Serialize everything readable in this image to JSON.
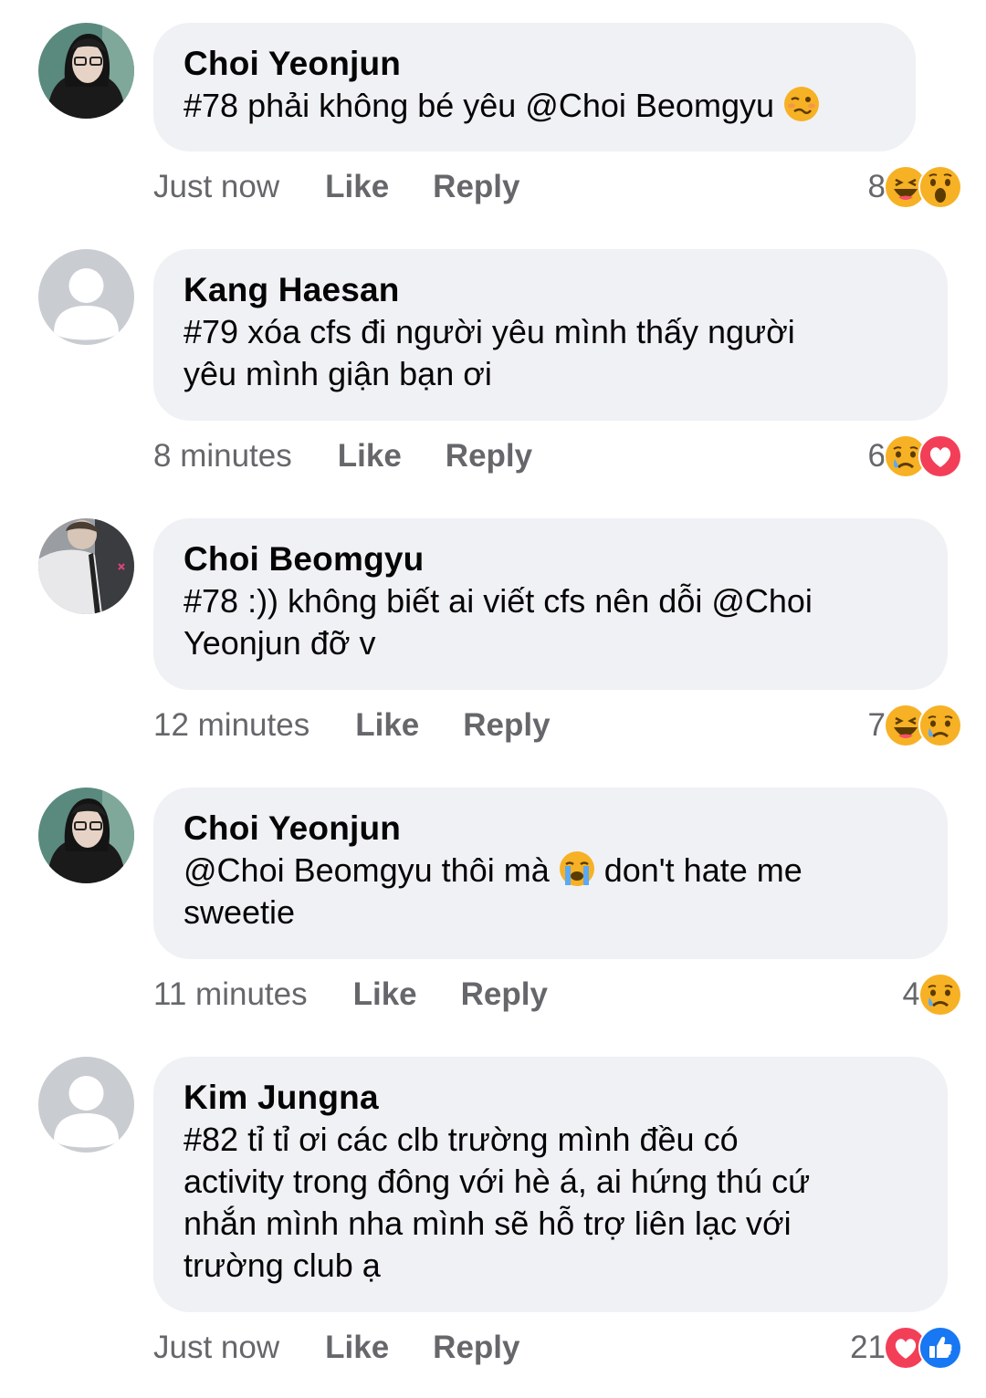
{
  "comments": [
    {
      "author": "Choi Yeonjun",
      "text_before": "#78 phải không bé yêu @Choi Beomgyu ",
      "emoji": "woozy-face",
      "text_after": "",
      "time": "Just now",
      "like": "Like",
      "reply": "Reply",
      "reaction_count": "8",
      "reactions": [
        "haha",
        "wow"
      ],
      "avatar": "photo-dark"
    },
    {
      "author": "Kang Haesan",
      "text_before": "#79 xóa cfs đi người yêu mình thấy người\nyêu mình giận bạn ơi",
      "emoji": "",
      "text_after": "",
      "time": "8 minutes",
      "like": "Like",
      "reply": "Reply",
      "reaction_count": "6",
      "reactions": [
        "sad",
        "love"
      ],
      "avatar": "default"
    },
    {
      "author": "Choi Beomgyu",
      "text_before": "#78 :)) không biết ai viết cfs nên dỗi @Choi\nYeonjun đỡ v",
      "emoji": "",
      "text_after": "",
      "time": "12 minutes",
      "like": "Like",
      "reply": "Reply",
      "reaction_count": "7",
      "reactions": [
        "haha",
        "sad"
      ],
      "avatar": "photo-light"
    },
    {
      "author": "Choi Yeonjun",
      "text_before": "@Choi Beomgyu thôi mà ",
      "emoji": "loudly-crying-face",
      "text_after": " don't hate me\nsweetie",
      "time": "11 minutes",
      "like": "Like",
      "reply": "Reply",
      "reaction_count": "4",
      "reactions": [
        "sad"
      ],
      "avatar": "photo-dark"
    },
    {
      "author": "Kim Jungna",
      "text_before": "#82 tỉ tỉ ơi các clb trường mình đều có\nactivity trong đông với hè á, ai hứng thú cứ\nnhắn mình nha mình sẽ hỗ trợ liên lạc với\ntrường club ạ",
      "emoji": "",
      "text_after": "",
      "time": "Just now",
      "like": "Like",
      "reply": "Reply",
      "reaction_count": "21",
      "reactions": [
        "love",
        "like"
      ],
      "avatar": "default"
    }
  ],
  "colors": {
    "bubble": "#f0f1f5",
    "meta_text": "#65676b",
    "love": "#f33e58",
    "like": "#1877f2",
    "emoji_yellow": "#f7b125"
  }
}
